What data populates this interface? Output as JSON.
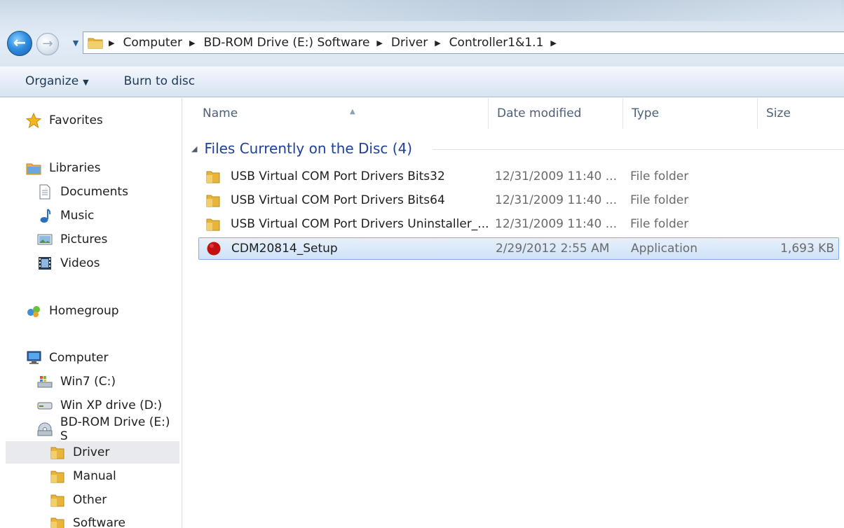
{
  "address": {
    "crumbs": [
      "Computer",
      "BD-ROM Drive (E:) Software",
      "Driver",
      "Controller1&1.1"
    ]
  },
  "toolbar": {
    "organize_label": "Organize",
    "burn_label": "Burn to disc"
  },
  "sidebar": {
    "favorites": "Favorites",
    "libraries": "Libraries",
    "documents": "Documents",
    "music": "Music",
    "pictures": "Pictures",
    "videos": "Videos",
    "homegroup": "Homegroup",
    "computer": "Computer",
    "drive_c": "Win7 (C:)",
    "drive_d": "Win XP drive (D:)",
    "drive_e": "BD-ROM Drive (E:) S",
    "folders": [
      "Driver",
      "Manual",
      "Other",
      "Software"
    ]
  },
  "columns": {
    "name": "Name",
    "date": "Date modified",
    "type": "Type",
    "size": "Size"
  },
  "group": {
    "title": "Files Currently on the Disc (4)"
  },
  "files": [
    {
      "name": "USB Virtual COM Port Drivers Bits32",
      "date": "12/31/2009 11:40 ...",
      "type": "File folder",
      "size": "",
      "icon": "folder-icon"
    },
    {
      "name": "USB Virtual COM Port Drivers Bits64",
      "date": "12/31/2009 11:40 ...",
      "type": "File folder",
      "size": "",
      "icon": "folder-icon"
    },
    {
      "name": "USB Virtual COM Port Drivers Uninstaller_...",
      "date": "12/31/2009 11:40 ...",
      "type": "File folder",
      "size": "",
      "icon": "folder-icon"
    },
    {
      "name": "CDM20814_Setup",
      "date": "2/29/2012 2:55 AM",
      "type": "Application",
      "size": "1,693 KB",
      "icon": "application-icon"
    }
  ],
  "colors": {
    "folder": "#e8b53a",
    "app_icon": "#c41010",
    "group_title": "#1e3f9a",
    "selection_border": "#84acdd"
  }
}
